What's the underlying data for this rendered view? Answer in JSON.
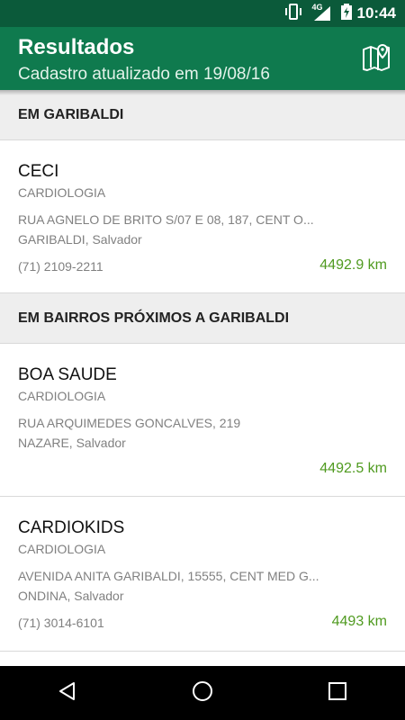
{
  "status_bar": {
    "network": "4G",
    "time": "10:44",
    "icons": [
      "vibrate-icon",
      "signal-icon",
      "battery-icon"
    ]
  },
  "app_bar": {
    "title": "Resultados",
    "subtitle": "Cadastro atualizado em 19/08/16",
    "action_icon": "map-icon"
  },
  "sections": [
    {
      "header": "EM GARIBALDI",
      "items": [
        {
          "name": "CECI",
          "specialty": "CARDIOLOGIA",
          "address_line1": "RUA AGNELO DE BRITO S/07 E 08, 187, CENT O...",
          "address_line2": "GARIBALDI, Salvador",
          "phone": "(71) 2109-2211",
          "distance": "4492.9 km"
        }
      ]
    },
    {
      "header": "EM BAIRROS PRÓXIMOS A GARIBALDI",
      "items": [
        {
          "name": "BOA SAUDE",
          "specialty": "CARDIOLOGIA",
          "address_line1": "RUA ARQUIMEDES GONCALVES, 219",
          "address_line2": "NAZARE, Salvador",
          "phone": "",
          "distance": "4492.5 km"
        },
        {
          "name": "CARDIOKIDS",
          "specialty": "CARDIOLOGIA",
          "address_line1": "AVENIDA ANITA GARIBALDI, 15555, CENT MED G...",
          "address_line2": "ONDINA, Salvador",
          "phone": "(71) 3014-6101",
          "distance": "4493 km"
        }
      ]
    }
  ],
  "colors": {
    "status_bar": "#0b5a3a",
    "app_bar": "#0f7a4e",
    "distance": "#4f9a1f",
    "section_bg": "#eeeeee"
  },
  "nav_bar": {
    "icons": [
      "back-icon",
      "home-icon",
      "recents-icon"
    ]
  }
}
